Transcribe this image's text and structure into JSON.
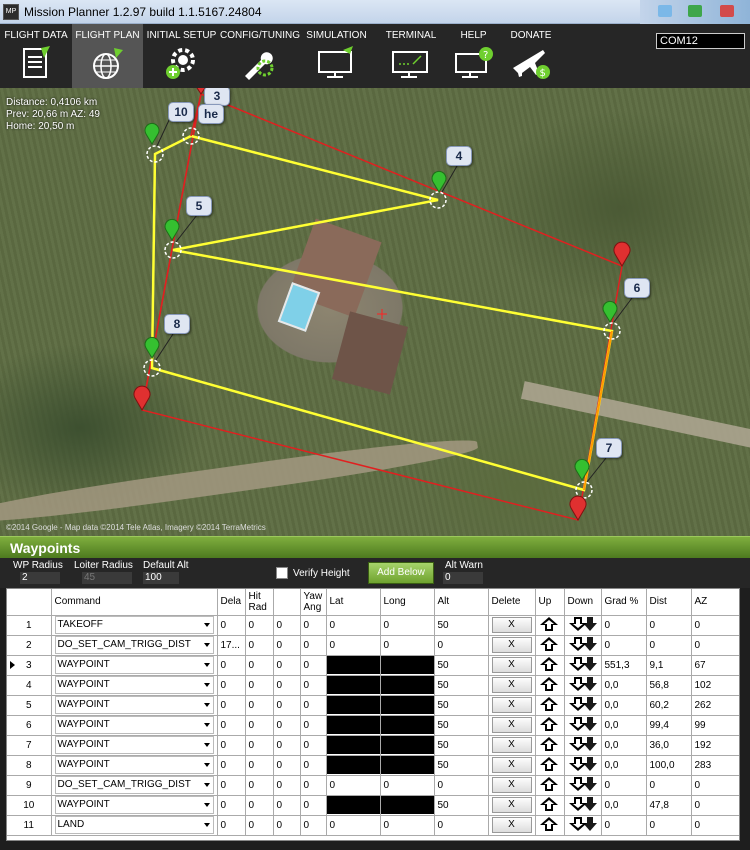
{
  "window": {
    "title": "Mission Planner 1.2.97 build 1.1.5167.24804",
    "icon_text": "MP"
  },
  "toolbar": {
    "items": [
      {
        "label": "FLIGHT DATA",
        "icon": "clipboard-icon",
        "active": false
      },
      {
        "label": "FLIGHT PLAN",
        "icon": "globe-icon",
        "active": true
      },
      {
        "label": "INITIAL SETUP",
        "icon": "gear-plus-icon",
        "active": false
      },
      {
        "label": "CONFIG/TUNING",
        "icon": "wrench-gear-icon",
        "active": false
      },
      {
        "label": "SIMULATION",
        "icon": "monitor-plane-icon",
        "active": false
      },
      {
        "label": "TERMINAL",
        "icon": "monitor-terminal-icon",
        "active": false
      },
      {
        "label": "HELP",
        "icon": "monitor-help-icon",
        "active": false
      },
      {
        "label": "DONATE",
        "icon": "plane-dollar-icon",
        "active": false
      }
    ],
    "port": "COM12"
  },
  "map": {
    "distance": "Distance: 0,4106 km",
    "prev": "Prev: 20,66 m AZ: 49",
    "home": "Home: 20,50 m",
    "copyright": "©2014 Google - Map data ©2014 Tele Atlas, Imagery ©2014 TerraMetrics",
    "labels": [
      "10",
      "3",
      "he",
      "4",
      "5",
      "6",
      "8",
      "7"
    ],
    "colors": {
      "path": "#ffff33",
      "polygon": "#e02020",
      "marker_green": "#35c030",
      "marker_red": "#e03030"
    }
  },
  "panel": {
    "title": "Waypoints",
    "wp_radius_label": "WP Radius",
    "wp_radius": "2",
    "loiter_radius_label": "Loiter Radius",
    "loiter_radius": "45",
    "default_alt_label": "Default Alt",
    "default_alt": "100",
    "verify_height_label": "Verify Height",
    "add_below_label": "Add Below",
    "alt_warn_label": "Alt Warn",
    "alt_warn": "0"
  },
  "grid": {
    "headers": [
      "",
      "Command",
      "Dela",
      "Hit Rad",
      "",
      "Yaw Ang",
      "Lat",
      "Long",
      "Alt",
      "Delete",
      "Up",
      "Down",
      "Grad %",
      "Dist",
      "AZ"
    ],
    "delete_label": "X",
    "rows": [
      {
        "n": "1",
        "cmd": "TAKEOFF",
        "p1": "0",
        "p2": "0",
        "p3": "0",
        "p4": "0",
        "lat": "0",
        "lng": "0",
        "alt": "50",
        "grad": "0",
        "dist": "0",
        "az": "0",
        "masked": false,
        "current": false
      },
      {
        "n": "2",
        "cmd": "DO_SET_CAM_TRIGG_DIST",
        "p1": "17...",
        "p2": "0",
        "p3": "0",
        "p4": "0",
        "lat": "0",
        "lng": "0",
        "alt": "0",
        "grad": "0",
        "dist": "0",
        "az": "0",
        "masked": false,
        "current": false
      },
      {
        "n": "3",
        "cmd": "WAYPOINT",
        "p1": "0",
        "p2": "0",
        "p3": "0",
        "p4": "0",
        "lat": "",
        "lng": "",
        "alt": "50",
        "grad": "551,3",
        "dist": "9,1",
        "az": "67",
        "masked": true,
        "current": true
      },
      {
        "n": "4",
        "cmd": "WAYPOINT",
        "p1": "0",
        "p2": "0",
        "p3": "0",
        "p4": "0",
        "lat": "",
        "lng": "",
        "alt": "50",
        "grad": "0,0",
        "dist": "56,8",
        "az": "102",
        "masked": true,
        "current": false
      },
      {
        "n": "5",
        "cmd": "WAYPOINT",
        "p1": "0",
        "p2": "0",
        "p3": "0",
        "p4": "0",
        "lat": "",
        "lng": "",
        "alt": "50",
        "grad": "0,0",
        "dist": "60,2",
        "az": "262",
        "masked": true,
        "current": false
      },
      {
        "n": "6",
        "cmd": "WAYPOINT",
        "p1": "0",
        "p2": "0",
        "p3": "0",
        "p4": "0",
        "lat": "",
        "lng": "",
        "alt": "50",
        "grad": "0,0",
        "dist": "99,4",
        "az": "99",
        "masked": true,
        "current": false
      },
      {
        "n": "7",
        "cmd": "WAYPOINT",
        "p1": "0",
        "p2": "0",
        "p3": "0",
        "p4": "0",
        "lat": "",
        "lng": "",
        "alt": "50",
        "grad": "0,0",
        "dist": "36,0",
        "az": "192",
        "masked": true,
        "current": false
      },
      {
        "n": "8",
        "cmd": "WAYPOINT",
        "p1": "0",
        "p2": "0",
        "p3": "0",
        "p4": "0",
        "lat": "",
        "lng": "",
        "alt": "50",
        "grad": "0,0",
        "dist": "100,0",
        "az": "283",
        "masked": true,
        "current": false
      },
      {
        "n": "9",
        "cmd": "DO_SET_CAM_TRIGG_DIST",
        "p1": "0",
        "p2": "0",
        "p3": "0",
        "p4": "0",
        "lat": "0",
        "lng": "0",
        "alt": "0",
        "grad": "0",
        "dist": "0",
        "az": "0",
        "masked": false,
        "current": false
      },
      {
        "n": "10",
        "cmd": "WAYPOINT",
        "p1": "0",
        "p2": "0",
        "p3": "0",
        "p4": "0",
        "lat": "",
        "lng": "",
        "alt": "50",
        "grad": "0,0",
        "dist": "47,8",
        "az": "0",
        "masked": true,
        "current": false
      },
      {
        "n": "11",
        "cmd": "LAND",
        "p1": "0",
        "p2": "0",
        "p3": "0",
        "p4": "0",
        "lat": "0",
        "lng": "0",
        "alt": "0",
        "grad": "0",
        "dist": "0",
        "az": "0",
        "masked": false,
        "current": false
      }
    ]
  }
}
